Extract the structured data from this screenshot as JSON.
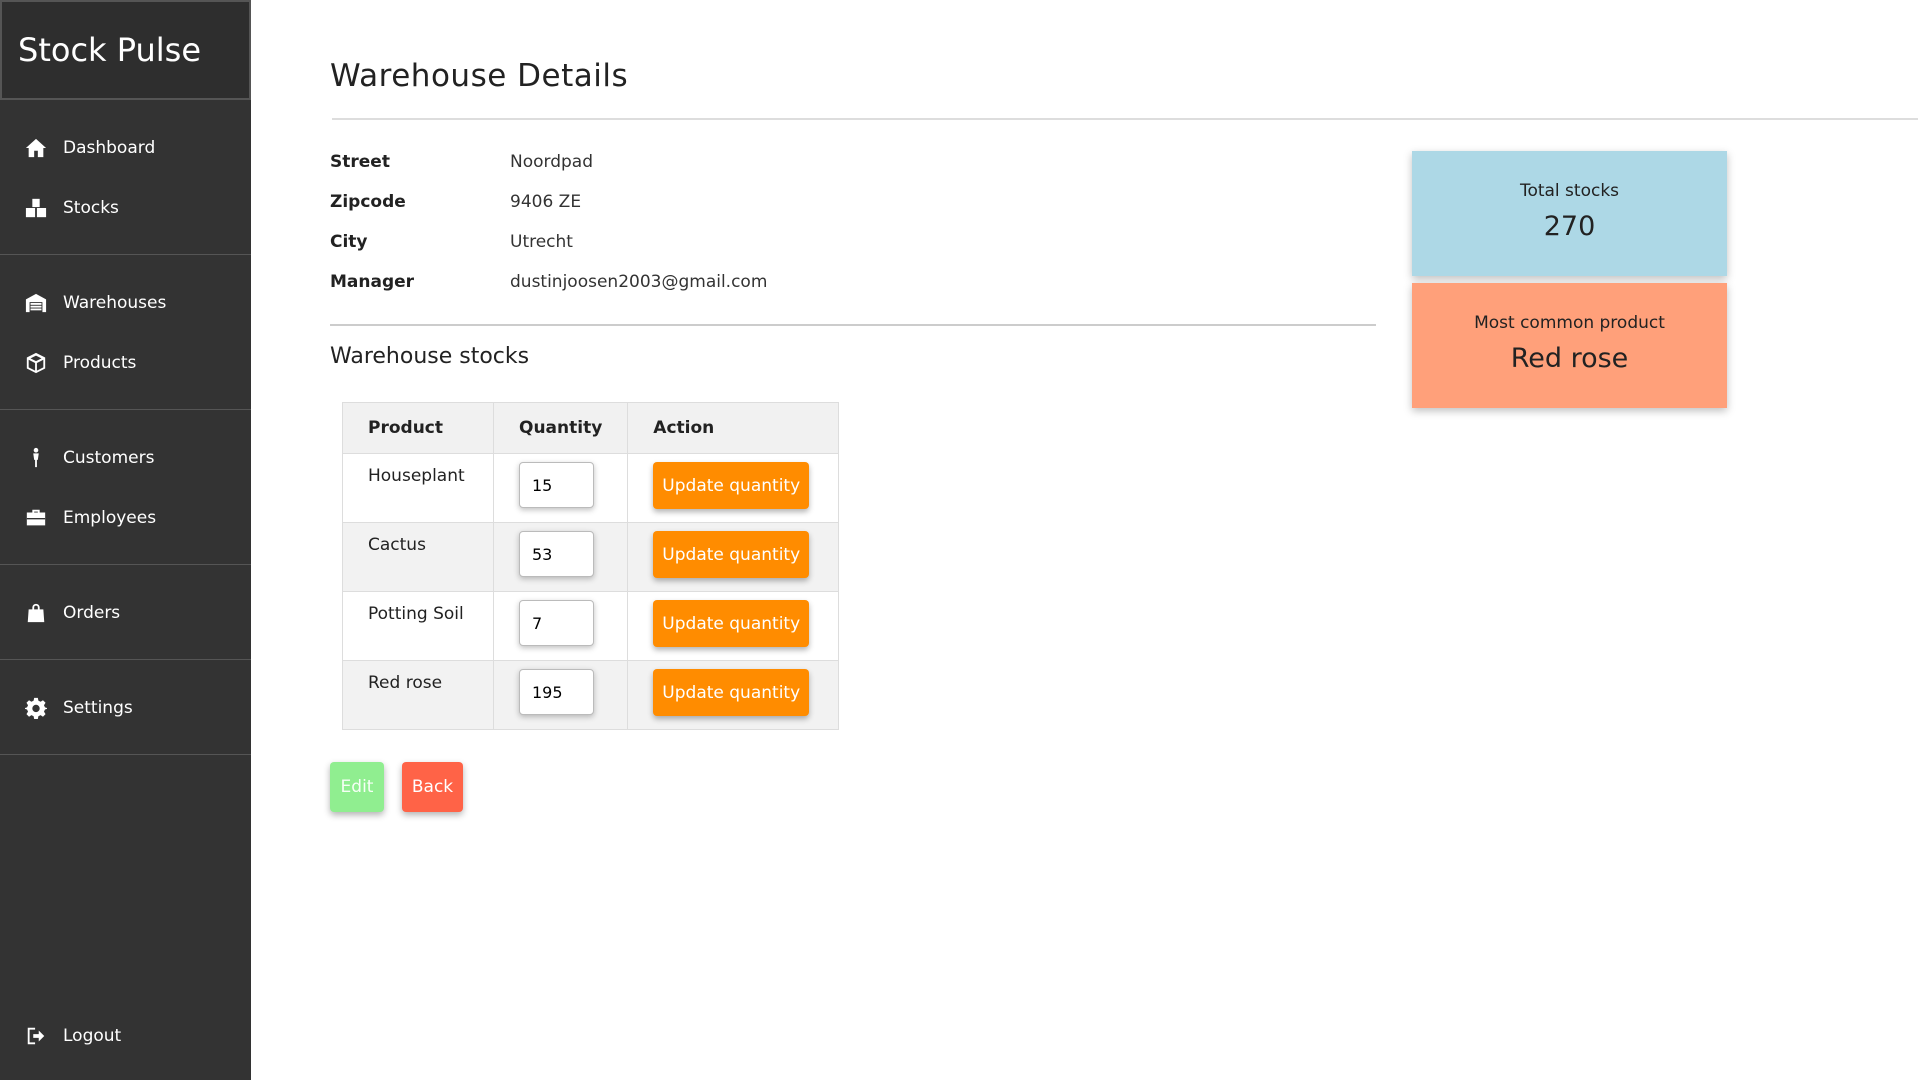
{
  "app": {
    "brand": "Stock Pulse"
  },
  "sidebar": {
    "groups": [
      {
        "items": [
          {
            "label": "Dashboard",
            "icon": "home-icon"
          },
          {
            "label": "Stocks",
            "icon": "boxes-icon"
          }
        ]
      },
      {
        "items": [
          {
            "label": "Warehouses",
            "icon": "warehouse-icon"
          },
          {
            "label": "Products",
            "icon": "box-icon"
          }
        ]
      },
      {
        "items": [
          {
            "label": "Customers",
            "icon": "person-icon"
          },
          {
            "label": "Employees",
            "icon": "briefcase-icon"
          }
        ]
      },
      {
        "items": [
          {
            "label": "Orders",
            "icon": "shopping-bag-icon"
          }
        ]
      },
      {
        "items": [
          {
            "label": "Settings",
            "icon": "gear-icon"
          }
        ]
      }
    ],
    "logout": {
      "label": "Logout",
      "icon": "logout-icon"
    }
  },
  "page": {
    "title": "Warehouse Details"
  },
  "details": {
    "street_label": "Street",
    "street": "Noordpad",
    "zipcode_label": "Zipcode",
    "zipcode": "9406 ZE",
    "city_label": "City",
    "city": "Utrecht",
    "manager_label": "Manager",
    "manager": "dustinjoosen2003@gmail.com"
  },
  "stocks": {
    "title": "Warehouse stocks",
    "columns": [
      "Product",
      "Quantity",
      "Action"
    ],
    "action_label": "Update quantity",
    "rows": [
      {
        "product": "Houseplant",
        "quantity": "15"
      },
      {
        "product": "Cactus",
        "quantity": "53"
      },
      {
        "product": "Potting Soil",
        "quantity": "7"
      },
      {
        "product": "Red rose",
        "quantity": "195"
      }
    ]
  },
  "buttons": {
    "edit": "Edit",
    "back": "Back"
  },
  "stats": {
    "total_label": "Total stocks",
    "total_value": "270",
    "common_label": "Most common product",
    "common_value": "Red rose"
  },
  "colors": {
    "sidebar_bg": "#333333",
    "update_button": "#ff8c00",
    "edit_button": "#90ee90",
    "back_button": "#ff6347",
    "total_card": "#add8e6",
    "common_card": "#ffa07a"
  }
}
